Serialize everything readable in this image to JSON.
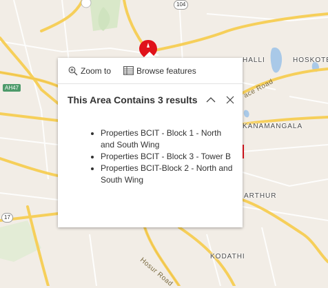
{
  "map": {
    "labels": {
      "hebbal_partial": "HALLI",
      "hoskote": "HOSKOTE",
      "kr_puram_partial": "KANAMANGALA",
      "bellandur_partial": "ARTHUR",
      "kodathi": "KODATHI"
    },
    "roads": {
      "nh104": "104",
      "ah47": "AH47",
      "nh17": "17",
      "hosur_road": "Hosur Road",
      "old_madras_road_partial": "ace Road"
    },
    "colors": {
      "background": "#f2ede6",
      "major_road": "#f6cf5a",
      "minor_road": "#ffffff",
      "water": "#a9c9e8",
      "park": "#cfe3bf",
      "marker": "#e0121a"
    }
  },
  "popup": {
    "actions": {
      "zoom_to": "Zoom to",
      "browse_features": "Browse features"
    },
    "title": "This Area Contains 3 results",
    "results": [
      "Properties BCIT - Block 1 - North and South Wing",
      "Properties BCIT - Block 3 - Tower B",
      "Properties BCIT-Block 2 - North and South Wing"
    ]
  }
}
